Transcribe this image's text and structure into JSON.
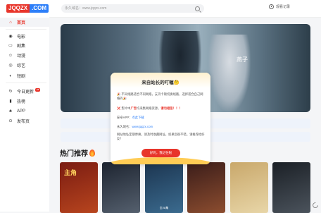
{
  "header": {
    "logo_left": "JQQZX",
    "logo_right": ".COM",
    "search_placeholder": "永久域名：www.jqqzx.com",
    "history_label": "观看记录"
  },
  "sidebar": {
    "items": [
      {
        "label": "首页",
        "icon": "home-icon",
        "glyph": "⌂"
      },
      {
        "label": "电影",
        "icon": "film-icon",
        "glyph": "◉"
      },
      {
        "label": "剧集",
        "icon": "tv-icon",
        "glyph": "▭"
      },
      {
        "label": "动漫",
        "icon": "anime-icon",
        "glyph": "☺"
      },
      {
        "label": "综艺",
        "icon": "variety-icon",
        "glyph": "◎"
      },
      {
        "label": "短剧",
        "icon": "short-drama-icon",
        "glyph": "◐"
      },
      {
        "label": "今日更新",
        "icon": "refresh-icon",
        "glyph": "↻",
        "badge": "28"
      },
      {
        "label": "热榜",
        "icon": "ranking-icon",
        "glyph": "▮"
      },
      {
        "label": "APP",
        "icon": "app-icon",
        "glyph": "♣"
      },
      {
        "label": "发布页",
        "icon": "link-icon",
        "glyph": "⊙"
      }
    ]
  },
  "banner": {
    "title": "燕子",
    "subtitle_lines": [
      "",
      "",
      ""
    ]
  },
  "section": {
    "hot_title": "热门推荐"
  },
  "posters": [
    {
      "title": "主角",
      "episode": "",
      "colors": [
        "#7a1c12",
        "#b8451e"
      ]
    },
    {
      "title": "",
      "episode": "",
      "colors": [
        "#1d2430",
        "#55606e"
      ]
    },
    {
      "title": "",
      "episode": "全28集",
      "colors": [
        "#1c3550",
        "#3b6b8f"
      ]
    },
    {
      "title": "",
      "episode": "",
      "colors": [
        "#3b1d1a",
        "#8c4d2f"
      ]
    },
    {
      "title": "",
      "episode": "",
      "colors": [
        "#c9a86b",
        "#e8d6a8"
      ]
    },
    {
      "title": "",
      "episode": "",
      "colors": [
        "#1b2026",
        "#4b535c"
      ]
    }
  ],
  "modal": {
    "title": "来自站长的叮嘱🤔",
    "line1": "🎉 不同线路适合不同网络，支持卡顿切换线路，选择适合自己网络的🎉",
    "line2_pre": "❌ 影片中",
    "line2_ad": "广告",
    "line2_mid": "均采集网络资源，",
    "line2_red": "请勿相信！！！",
    "line3_label": "安卓APP：",
    "line3_link": "点此下载",
    "line4_label": "永久域名：",
    "line4_link": "www.jqqzx.com",
    "line5": "网站地址定期更换，请及时收藏网址，如果您很不错，请推荐给好友！",
    "button": "好的，我记住啦"
  },
  "colors": {
    "accent": "#e8352b",
    "brand_blue": "#2d7ff9"
  }
}
